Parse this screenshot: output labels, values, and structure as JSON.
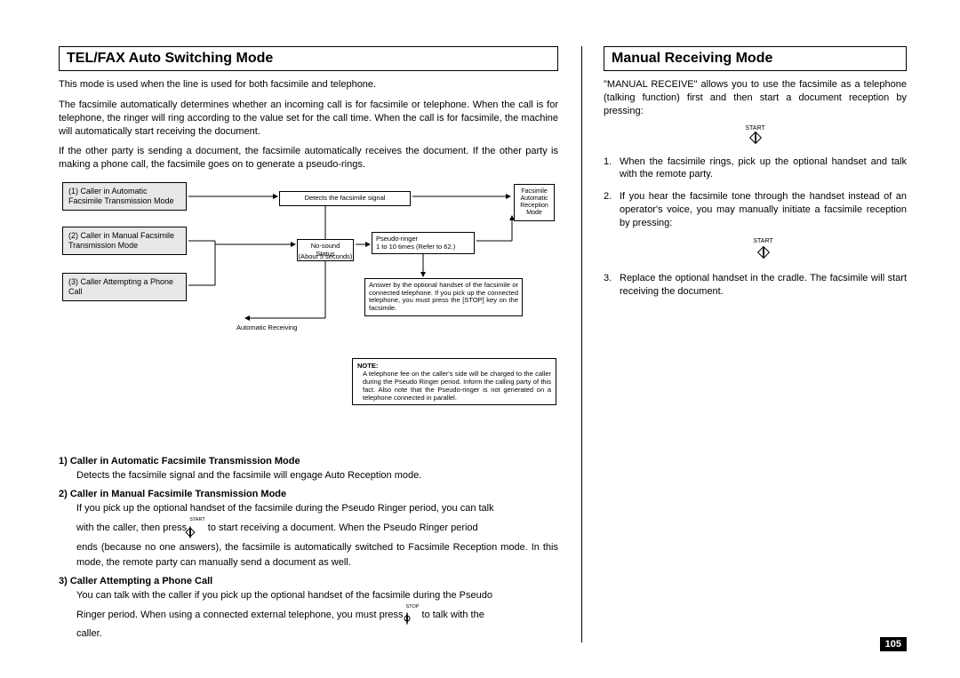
{
  "left": {
    "title": "TEL/FAX Auto Switching Mode",
    "p1": "This mode is used when the line is used for both facsimile and telephone.",
    "p2": "The facsimile automatically determines whether an incoming call is for facsimile or telephone. When the call is for telephone, the ringer will ring according to the value set for the call time. When the call is for facsimile, the machine will automatically start receiving the document.",
    "p3": "If the other party is sending a document, the facsimile automatically receives the document. If the other party is making a phone call, the facsimile goes on to generate a pseudo-rings.",
    "diagram": {
      "box1": "(1) Caller in Automatic Facsimile Transmission Mode",
      "box2": "(2) Caller in Manual Facsimile Transmission Mode",
      "box3": "(3) Caller Attempting a Phone Call",
      "detect": "Detects the facsimile signal",
      "nosound": "No-sound Status",
      "about5": "(About 5 seconds)",
      "pseudo": "Pseudo-ringer\n1 to 10 times (Refer to 62.)",
      "faxmode": "Facsimile Automatic Reception Mode",
      "answer": "Answer by the optional handset of the facsimile or connected telephone. If you pick up the connected telephone, you must press the [STOP] key on the facsimile.",
      "autorecv": "Automatic Receiving",
      "note_label": "NOTE:",
      "note": "A telephone fee on the caller's side will be charged to the caller during the Pseudo Ringer period. Inform the calling party of this fact. Also note that the Pseudo-ringer is not generated on a telephone connected in parallel."
    },
    "items": [
      {
        "head": "1)  Caller in Automatic Facsimile Transmission Mode",
        "body": "Detects the facsimile signal and the facsimile will engage Auto Reception mode."
      },
      {
        "head": "2)  Caller in Manual Facsimile Transmission Mode",
        "body1": "If you pick up the optional handset of the facsimile during the Pseudo Ringer period, you can talk",
        "body2a": "with the caller, then press ",
        "body2b": " to start receiving a document. When the Pseudo Ringer period",
        "body3": "ends (because no one answers), the facsimile is automatically switched to Facsimile Reception mode. In this mode, the remote party can manually send a document as well."
      },
      {
        "head": "3)  Caller Attempting a Phone Call",
        "body1": "You can talk with the caller if you pick up the optional handset of the facsimile during the Pseudo",
        "body2a": "Ringer period. When using a connected external telephone, you must press ",
        "body2b": " to talk with the",
        "body3": "caller."
      }
    ]
  },
  "right": {
    "title": "Manual Receiving Mode",
    "intro": "\"MANUAL RECEIVE\" allows you to use the facsimile as a telephone (talking function) first and then start a document reception by pressing:",
    "step1": "When the facsimile rings, pick up the optional handset and talk with the remote party.",
    "step2": "If you hear the facsimile tone through the handset instead of an operator's voice, you may manually initiate a facsimile reception by pressing:",
    "step3": "Replace the optional handset in the cradle. The facsimile will start receiving the document."
  },
  "btn_start": "START",
  "btn_stop": "STOP",
  "page_number": "105"
}
